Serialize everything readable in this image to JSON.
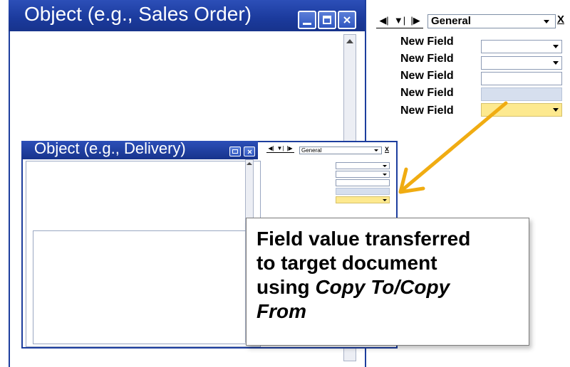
{
  "main_window": {
    "title": "Object (e.g., Sales Order)",
    "title_buttons": [
      "minimize-icon",
      "maximize-icon",
      "close-icon"
    ]
  },
  "field_panel": {
    "nav": {
      "prev": "◀|",
      "down": "▼|",
      "next": "|▶",
      "selected_tab": "General",
      "close": "X"
    },
    "fields": [
      {
        "label": "New Field",
        "type": "dropdown",
        "color": "#ffffff"
      },
      {
        "label": "New Field",
        "type": "dropdown",
        "color": "#ffffff"
      },
      {
        "label": "New Field",
        "type": "text",
        "color": "#ffffff"
      },
      {
        "label": "New Field",
        "type": "readonly",
        "color": "#d6dfee"
      },
      {
        "label": "New Field",
        "type": "dropdown",
        "color": "#fde98f"
      }
    ]
  },
  "delivery_window": {
    "title": "Object (e.g., Delivery)",
    "nav": {
      "prev": "◀|",
      "down": "▼|",
      "next": "|▶",
      "selected_tab": "General",
      "close": "X"
    }
  },
  "callout": {
    "line1": "Field value transferred",
    "line2": "to target document",
    "line3_prefix": "using ",
    "line3_italic": "Copy To/Copy",
    "line4_italic": "From"
  },
  "colors": {
    "title_bar": "#1b3a9c",
    "arrow": "#f0ac12",
    "highlight_field": "#fde98f",
    "readonly_field": "#d6dfee"
  }
}
